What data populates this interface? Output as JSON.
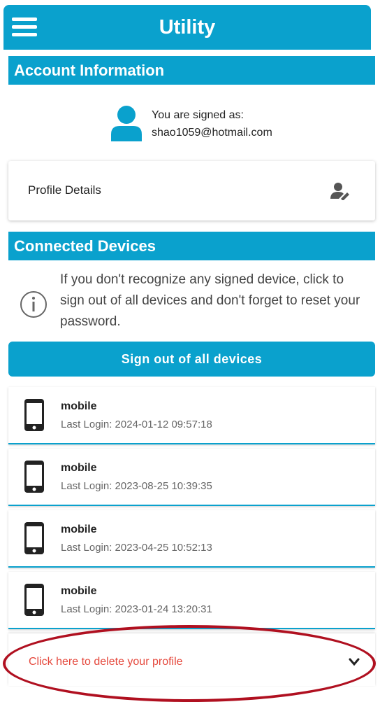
{
  "app_bar": {
    "title": "Utility"
  },
  "account": {
    "header": "Account Information",
    "signed_as_label": "You are signed as:",
    "email": "shao1059@hotmail.com"
  },
  "profile": {
    "label": "Profile Details"
  },
  "devices": {
    "header": "Connected Devices",
    "info": "If you don't recognize any signed device, click to sign out of all devices and don't forget to reset your password.",
    "sign_out_all": "Sign out of all devices",
    "items": [
      {
        "name": "mobile",
        "last_login": "Last Login: 2024-01-12 09:57:18"
      },
      {
        "name": "mobile",
        "last_login": "Last Login: 2023-08-25 10:39:35"
      },
      {
        "name": "mobile",
        "last_login": "Last Login: 2023-04-25 10:52:13"
      },
      {
        "name": "mobile",
        "last_login": "Last Login: 2023-01-24 13:20:31"
      }
    ]
  },
  "delete_profile": {
    "label": "Click here to delete your profile"
  },
  "colors": {
    "accent": "#0aa1cd",
    "danger_text": "#e5483c",
    "highlight_ring": "#b01020"
  },
  "icons": [
    "menu-icon",
    "user-icon",
    "edit-user-icon",
    "info-icon",
    "phone-icon",
    "chevron-down-icon"
  ]
}
